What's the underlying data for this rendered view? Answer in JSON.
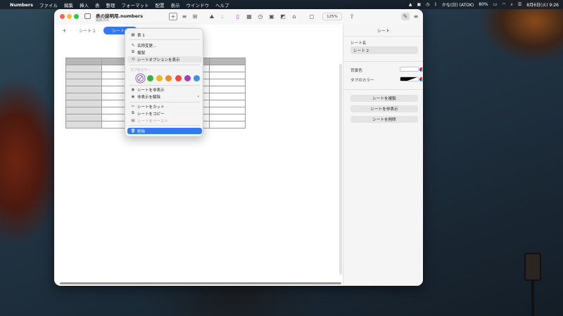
{
  "menubar": {
    "apple_icon": "apple-logo-icon",
    "app_name": "Numbers",
    "items": [
      "ファイル",
      "編集",
      "挿入",
      "表",
      "整理",
      "フォーマット",
      "配置",
      "表示",
      "ウインドウ",
      "ヘルプ"
    ],
    "ime": "かな(日) (ATOK)",
    "battery": "80%",
    "clock": "8月6日(火) 9:26"
  },
  "window": {
    "doc_title": "表の説明用.numbers",
    "doc_subtitle": "編集済み",
    "zoom": "125%"
  },
  "tabs": {
    "add_icon": "plus-icon",
    "items": [
      {
        "label": "シート 1",
        "active": false
      },
      {
        "label": "シート 2",
        "active": true
      }
    ]
  },
  "context_menu": {
    "items": [
      {
        "label": "表 1",
        "icon": "table-icon"
      },
      {
        "label": "名称変更...",
        "icon": "pencil-icon"
      },
      {
        "label": "複製",
        "icon": "duplicate-icon"
      },
      {
        "label": "シートオプションを表示",
        "icon": "sheet-options-icon"
      },
      {
        "label": "シートを非表示",
        "icon": "eye-icon"
      },
      {
        "label": "非表示を解除",
        "icon": "eye-icon"
      },
      {
        "label": "シートをカット",
        "icon": "scissors-icon"
      },
      {
        "label": "シートをコピー",
        "icon": "copy-icon"
      },
      {
        "label": "シートをペースト",
        "icon": "paste-icon"
      },
      {
        "label": "削除",
        "icon": "trash-icon"
      }
    ],
    "tab_color_header": "タブのカラー",
    "tab_colors": [
      "#35b13f",
      "#f2b726",
      "#ef8a2b",
      "#ea4d3d",
      "#a63fb7",
      "#3d8ff0"
    ],
    "accent": "#3478f6"
  },
  "inspector": {
    "title": "シート",
    "sheet_name_label": "シート名",
    "sheet_name_value": "シート 2",
    "background_label": "背景色",
    "tab_color_label": "タブのカラー",
    "buttons": [
      "シートを複製",
      "シートを非表示",
      "シートを削除"
    ]
  }
}
